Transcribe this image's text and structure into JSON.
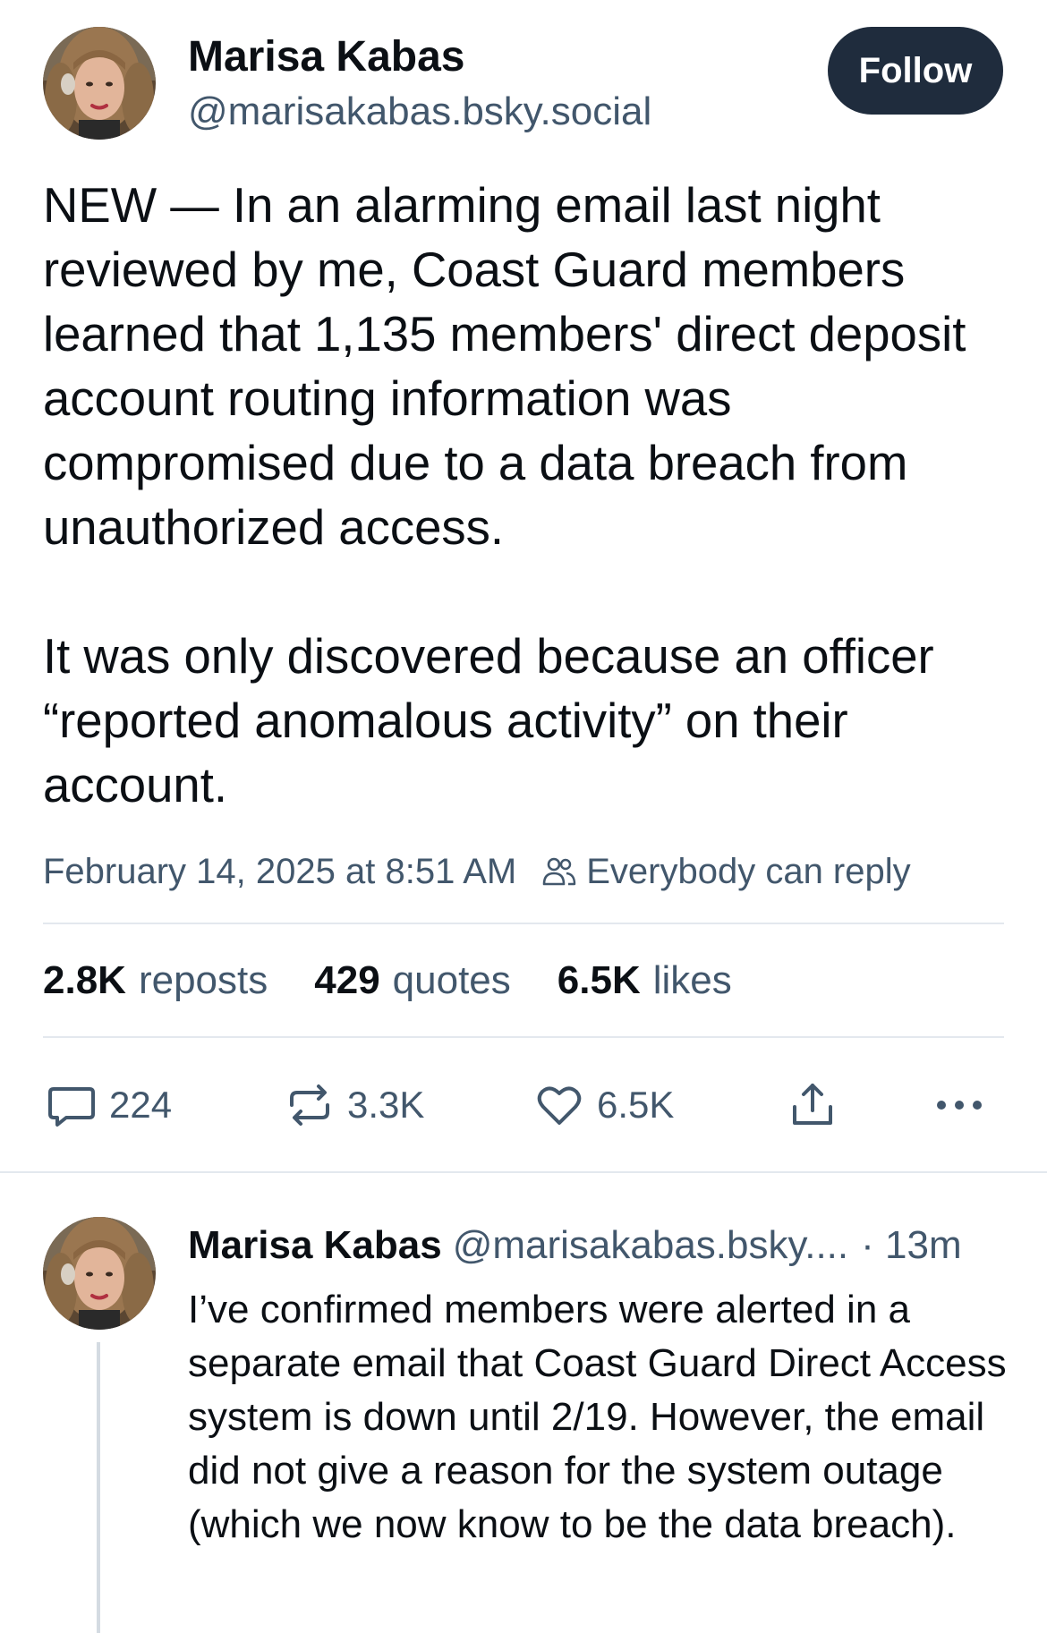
{
  "post": {
    "author_name": "Marisa Kabas",
    "author_handle": "@marisakabas.bsky.social",
    "follow_label": "Follow",
    "text": "NEW — In an alarming email last night reviewed by me, Coast Guard members learned that 1,135 members' direct deposit account routing information was compromised due to a data breach from unauthorized access.\n\nIt was only discovered because an officer “reported anomalous activity” on their account.",
    "timestamp": "February 14, 2025 at 8:51 AM",
    "reply_setting": "Everybody can reply",
    "stats": {
      "reposts_count": "2.8K",
      "reposts_label": "reposts",
      "quotes_count": "429",
      "quotes_label": "quotes",
      "likes_count": "6.5K",
      "likes_label": "likes"
    },
    "actions": {
      "reply_count": "224",
      "repost_count": "3.3K",
      "like_count": "6.5K"
    }
  },
  "reply": {
    "author_name": "Marisa Kabas",
    "author_handle": "@marisakabas.bsky....",
    "time": "· 13m",
    "text": "I’ve confirmed members were alerted in a separate email that Coast Guard Direct Access system is down until 2/19. However, the email did not give a reason for the system outage (which we now know to be the data breach)."
  },
  "icons": {
    "people": "people-icon",
    "reply": "speech-bubble-icon",
    "repost": "repost-arrows-icon",
    "like": "heart-icon",
    "share": "share-upload-icon",
    "more": "more-dots-icon"
  },
  "colors": {
    "text_primary": "#0b0f14",
    "text_secondary": "#42576c",
    "follow_button_bg": "#1f2c3d",
    "divider": "#e3e8ee",
    "thread_line": "#d4dbe2"
  }
}
